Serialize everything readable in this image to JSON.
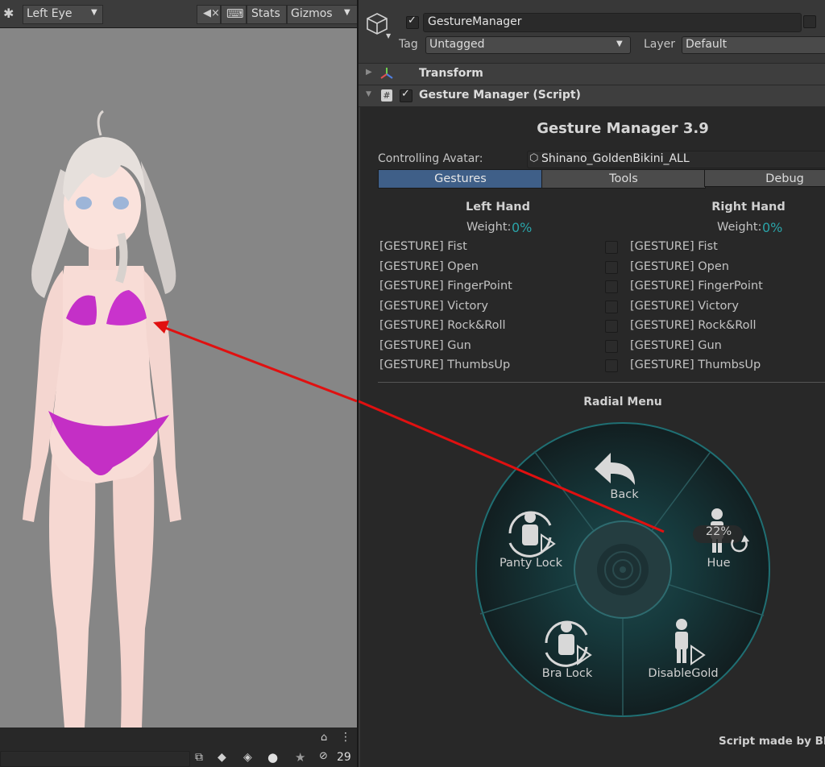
{
  "scene": {
    "camera_mode": "Left Eye",
    "stats_label": "Stats",
    "gizmos_label": "Gizmos",
    "hidden_count": "29"
  },
  "inspector": {
    "object_name": "GestureManager",
    "tag_label": "Tag",
    "tag_value": "Untagged",
    "layer_label": "Layer",
    "layer_value": "Default",
    "transform_label": "Transform",
    "component_label": "Gesture Manager (Script)"
  },
  "gm": {
    "title": "Gesture Manager 3.9",
    "avatar_label": "Controlling Avatar:",
    "avatar_value": "Shinano_GoldenBikini_ALL",
    "tabs": [
      "Gestures",
      "Tools",
      "Debug"
    ],
    "left_hand": "Left Hand",
    "right_hand": "Right Hand",
    "weight_label": "Weight:",
    "left_weight": "0%",
    "right_weight": "0%",
    "left_gestures": [
      "[GESTURE] Fist",
      "[GESTURE] Open",
      "[GESTURE] FingerPoint",
      "[GESTURE] Victory",
      "[GESTURE] Rock&Roll",
      "[GESTURE] Gun",
      "[GESTURE] ThumbsUp"
    ],
    "right_gestures": [
      "[GESTURE] Fist",
      "[GESTURE] Open",
      "[GESTURE] FingerPoint",
      "[GESTURE] Victory",
      "[GESTURE] Rock&Roll",
      "[GESTURE] Gun",
      "[GESTURE] ThumbsUp"
    ],
    "radial_title": "Radial Menu",
    "radial": {
      "back": "Back",
      "hue": "Hue",
      "hue_value": "22%",
      "panty_lock": "Panty Lock",
      "bra_lock": "Bra Lock",
      "disable_gold": "DisableGold"
    },
    "footer": "Script made by Blac"
  },
  "colors": {
    "accent": "#2aa3a8",
    "tab_active": "#3f5f88",
    "arrow": "#e01010"
  }
}
